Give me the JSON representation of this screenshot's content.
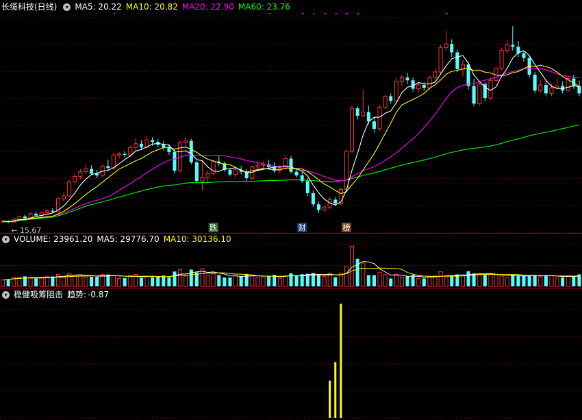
{
  "main_panel": {
    "title": "长缆科技(日线)",
    "ma5_label": "MA5: 20.22",
    "ma10_label": "MA10: 20.82",
    "ma20_label": "MA20: 22.90",
    "ma60_label": "MA60: 23.76",
    "low_price_annotation": "← 15.67",
    "markers": [
      "跌",
      "财",
      "榜"
    ]
  },
  "volume_panel": {
    "title": "VOLUME: 23961.20",
    "ma5_label": "MA5: 29776.70",
    "ma10_label": "MA10: 30136.10"
  },
  "indicator_panel": {
    "title": "稳健吸筹阻击",
    "trend_label": "趋势:",
    "trend_value": "-0.87"
  },
  "colors": {
    "up": "#ff3232",
    "down": "#54ffff",
    "ma5": "#ffffff",
    "ma10": "#ffff00",
    "ma20": "#ff00ff",
    "ma60": "#00ff00",
    "grid": "#7a0000",
    "indicator_bar": "#ffff00"
  },
  "chart_data": {
    "type": "candlestick",
    "price_axis": [
      15.0,
      38.0
    ],
    "low_marker_value": 15.67,
    "candles": [
      [
        15.8,
        16.0,
        15.7,
        15.9
      ],
      [
        15.9,
        16.0,
        15.67,
        15.8
      ],
      [
        15.8,
        16.3,
        15.7,
        16.1
      ],
      [
        16.1,
        16.5,
        16.0,
        16.4
      ],
      [
        16.4,
        16.6,
        16.1,
        16.2
      ],
      [
        16.2,
        16.8,
        16.1,
        16.7
      ],
      [
        16.7,
        16.9,
        16.4,
        16.5
      ],
      [
        16.5,
        16.9,
        16.3,
        16.8
      ],
      [
        16.8,
        17.2,
        16.6,
        17.0
      ],
      [
        17.0,
        17.3,
        16.8,
        16.9
      ],
      [
        16.9,
        18.5,
        16.8,
        18.3
      ],
      [
        18.3,
        19.0,
        18.0,
        18.6
      ],
      [
        18.6,
        20.3,
        18.5,
        20.1
      ],
      [
        20.1,
        21.0,
        19.8,
        20.7
      ],
      [
        20.7,
        21.5,
        20.4,
        21.2
      ],
      [
        21.2,
        22.0,
        20.9,
        21.5
      ],
      [
        21.5,
        21.9,
        20.8,
        21.0
      ],
      [
        21.0,
        21.4,
        20.5,
        20.8
      ],
      [
        20.8,
        22.0,
        20.6,
        21.8
      ],
      [
        21.8,
        22.5,
        21.3,
        21.6
      ],
      [
        21.6,
        23.2,
        21.4,
        23.0
      ],
      [
        23.0,
        23.3,
        22.6,
        23.1
      ],
      [
        23.1,
        23.4,
        22.8,
        23.0
      ],
      [
        23.0,
        24.0,
        22.8,
        23.8
      ],
      [
        23.8,
        24.8,
        23.4,
        24.2
      ],
      [
        24.2,
        24.6,
        23.5,
        23.8
      ],
      [
        23.8,
        25.0,
        23.6,
        24.6
      ],
      [
        24.6,
        24.9,
        24.0,
        24.4
      ],
      [
        24.4,
        24.7,
        23.8,
        24.1
      ],
      [
        24.1,
        24.5,
        23.5,
        23.8
      ],
      [
        23.8,
        24.2,
        23.0,
        23.3
      ],
      [
        23.3,
        23.6,
        21.0,
        21.3
      ],
      [
        21.3,
        24.5,
        21.1,
        24.3
      ],
      [
        24.3,
        24.9,
        23.8,
        24.5
      ],
      [
        24.5,
        24.7,
        22.0,
        22.2
      ],
      [
        22.2,
        22.4,
        20.0,
        20.2
      ],
      [
        20.2,
        22.5,
        19.2,
        20.6
      ],
      [
        20.6,
        21.3,
        20.0,
        21.0
      ],
      [
        21.0,
        22.5,
        20.8,
        22.3
      ],
      [
        22.3,
        22.9,
        21.8,
        22.1
      ],
      [
        22.1,
        22.3,
        21.2,
        21.4
      ],
      [
        21.4,
        21.6,
        20.7,
        20.9
      ],
      [
        20.9,
        21.8,
        20.6,
        21.4
      ],
      [
        21.4,
        21.8,
        20.9,
        21.2
      ],
      [
        21.2,
        21.5,
        20.2,
        20.5
      ],
      [
        20.5,
        21.9,
        20.3,
        21.7
      ],
      [
        21.7,
        22.3,
        21.3,
        21.9
      ],
      [
        21.9,
        22.3,
        21.5,
        22.0
      ],
      [
        22.0,
        22.5,
        21.5,
        21.7
      ],
      [
        21.7,
        22.2,
        21.1,
        21.3
      ],
      [
        21.3,
        21.9,
        21.0,
        21.6
      ],
      [
        21.6,
        22.9,
        21.4,
        22.6
      ],
      [
        22.6,
        22.9,
        21.0,
        21.2
      ],
      [
        21.2,
        21.5,
        20.6,
        20.8
      ],
      [
        20.8,
        21.2,
        20.0,
        20.2
      ],
      [
        20.2,
        20.5,
        18.6,
        18.9
      ],
      [
        18.9,
        19.2,
        17.4,
        17.7
      ],
      [
        17.7,
        18.0,
        16.8,
        17.1
      ],
      [
        17.1,
        17.6,
        16.9,
        17.4
      ],
      [
        17.4,
        18.5,
        17.2,
        18.2
      ],
      [
        18.2,
        18.5,
        17.5,
        17.8
      ],
      [
        17.8,
        19.5,
        17.6,
        19.3
      ],
      [
        19.3,
        23.6,
        19.1,
        23.4
      ],
      [
        23.4,
        28.3,
        23.2,
        28.0
      ],
      [
        28.0,
        28.2,
        26.8,
        27.2
      ],
      [
        27.2,
        30.0,
        27.0,
        27.6
      ],
      [
        27.6,
        28.3,
        26.3,
        26.6
      ],
      [
        26.6,
        27.1,
        25.4,
        25.8
      ],
      [
        25.8,
        28.3,
        25.6,
        28.1
      ],
      [
        28.1,
        29.5,
        27.9,
        29.3
      ],
      [
        29.3,
        29.6,
        28.5,
        28.8
      ],
      [
        28.8,
        31.3,
        28.6,
        30.9
      ],
      [
        30.9,
        31.6,
        30.4,
        31.3
      ],
      [
        31.3,
        31.8,
        30.6,
        31.0
      ],
      [
        31.0,
        31.3,
        29.8,
        30.1
      ],
      [
        30.1,
        30.8,
        29.7,
        30.5
      ],
      [
        30.5,
        30.8,
        29.9,
        30.2
      ],
      [
        30.2,
        31.5,
        30.0,
        31.3
      ],
      [
        31.3,
        32.3,
        30.8,
        31.9
      ],
      [
        31.9,
        34.8,
        31.6,
        34.5
      ],
      [
        34.5,
        36.3,
        34.2,
        34.9
      ],
      [
        34.9,
        35.4,
        33.5,
        34.0
      ],
      [
        34.0,
        34.3,
        31.9,
        32.2
      ],
      [
        32.2,
        33.2,
        31.4,
        32.7
      ],
      [
        32.7,
        33.0,
        30.0,
        30.4
      ],
      [
        30.4,
        31.2,
        28.2,
        28.5
      ],
      [
        28.5,
        30.8,
        28.3,
        30.6
      ],
      [
        30.6,
        30.8,
        28.8,
        29.1
      ],
      [
        29.1,
        31.3,
        28.9,
        31.0
      ],
      [
        31.0,
        32.5,
        30.8,
        32.3
      ],
      [
        32.3,
        34.5,
        32.1,
        34.2
      ],
      [
        34.2,
        35.3,
        33.9,
        34.8
      ],
      [
        34.8,
        36.8,
        34.2,
        34.6
      ],
      [
        34.6,
        35.2,
        33.5,
        33.9
      ],
      [
        33.9,
        34.2,
        33.0,
        33.4
      ],
      [
        33.4,
        33.6,
        31.3,
        31.6
      ],
      [
        31.6,
        31.9,
        29.6,
        29.9
      ],
      [
        29.9,
        31.1,
        29.7,
        30.5
      ],
      [
        30.5,
        31.0,
        29.3,
        29.6
      ],
      [
        29.6,
        30.6,
        29.3,
        30.2
      ],
      [
        30.2,
        31.3,
        30.0,
        30.4
      ],
      [
        30.4,
        30.9,
        29.6,
        29.9
      ],
      [
        29.9,
        31.5,
        29.7,
        31.2
      ],
      [
        31.2,
        31.6,
        30.1,
        30.4
      ],
      [
        30.4,
        31.0,
        29.3,
        29.6
      ]
    ],
    "volume_axis_max": 5000,
    "ma_series": [
      "MA5",
      "MA10",
      "MA20",
      "MA60"
    ],
    "indicator_bars": [
      {
        "index": 59,
        "value": 1.6
      },
      {
        "index": 60,
        "value": 2.4
      },
      {
        "index": 61,
        "value": 4.9
      }
    ],
    "indicator_axis_max": 5.0
  }
}
